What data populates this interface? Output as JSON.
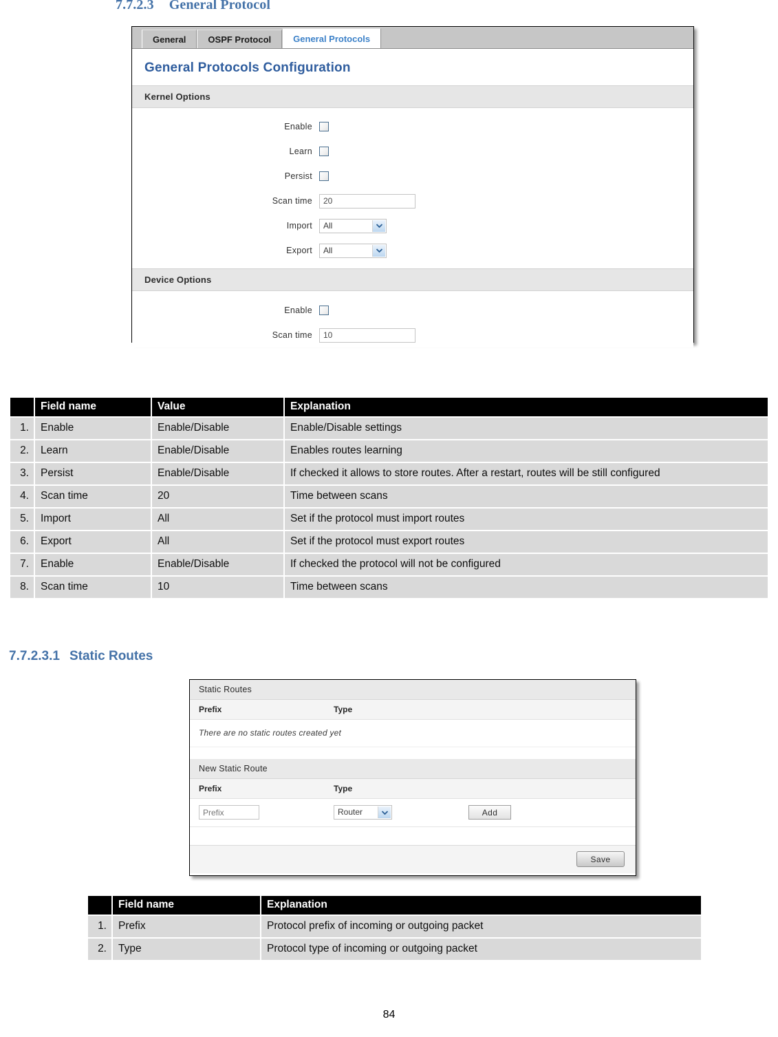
{
  "headings": {
    "section1_num": "7.7.2.3",
    "section1_title": "General Protocol",
    "section2_num": "7.7.2.3.1",
    "section2_title": "Static Routes"
  },
  "screenshot1": {
    "tabs": [
      {
        "label": "General",
        "active": false
      },
      {
        "label": "OSPF Protocol",
        "active": false
      },
      {
        "label": "General Protocols",
        "active": true
      }
    ],
    "panel_title": "General Protocols Configuration",
    "kernel_options": {
      "section_label": "Kernel Options",
      "enable_label": "Enable",
      "enable_checked": false,
      "learn_label": "Learn",
      "learn_checked": false,
      "persist_label": "Persist",
      "persist_checked": false,
      "scan_time_label": "Scan time",
      "scan_time_value": "20",
      "import_label": "Import",
      "import_value": "All",
      "export_label": "Export",
      "export_value": "All"
    },
    "device_options": {
      "section_label": "Device Options",
      "enable_label": "Enable",
      "enable_checked": false,
      "scan_time_label": "Scan time",
      "scan_time_value": "10"
    }
  },
  "table1": {
    "headers": [
      "",
      "Field name",
      "Value",
      "Explanation"
    ],
    "rows": [
      {
        "num": "1.",
        "field": "Enable",
        "value": "Enable/Disable",
        "explanation": "Enable/Disable settings"
      },
      {
        "num": "2.",
        "field": "Learn",
        "value": "Enable/Disable",
        "explanation": "Enables routes learning"
      },
      {
        "num": "3.",
        "field": "Persist",
        "value": "Enable/Disable",
        "explanation": "If checked it allows to store routes. After a restart, routes will be still configured"
      },
      {
        "num": "4.",
        "field": "Scan time",
        "value": "20",
        "explanation": "Time between scans"
      },
      {
        "num": "5.",
        "field": "Import",
        "value": "All",
        "explanation": "Set if the protocol must import routes"
      },
      {
        "num": "6.",
        "field": "Export",
        "value": "All",
        "explanation": "Set if the protocol must export routes"
      },
      {
        "num": "7.",
        "field": "Enable",
        "value": "Enable/Disable",
        "explanation": "If checked the protocol will not be configured"
      },
      {
        "num": "8.",
        "field": "Scan time",
        "value": "10",
        "explanation": "Time between scans"
      }
    ]
  },
  "screenshot2": {
    "static_routes": {
      "section_label": "Static Routes",
      "col_prefix": "Prefix",
      "col_type": "Type",
      "empty_message": "There are no static routes created yet"
    },
    "new_static_route": {
      "section_label": "New Static Route",
      "col_prefix": "Prefix",
      "col_type": "Type",
      "prefix_placeholder": "Prefix",
      "prefix_value": "",
      "type_value": "Router",
      "add_label": "Add"
    },
    "save_label": "Save"
  },
  "table2": {
    "headers": [
      "",
      "Field name",
      "Explanation"
    ],
    "rows": [
      {
        "num": "1.",
        "field": "Prefix",
        "explanation": "Protocol prefix of incoming or outgoing packet"
      },
      {
        "num": "2.",
        "field": "Type",
        "explanation": "Protocol type of incoming or outgoing packet"
      }
    ]
  },
  "page_number": "84"
}
